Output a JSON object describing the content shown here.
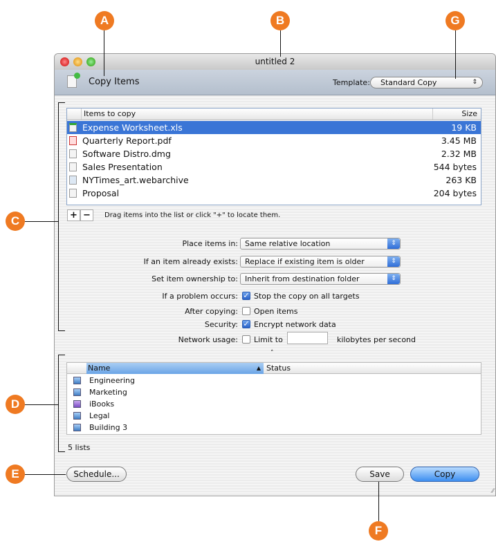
{
  "callouts": {
    "a": "A",
    "b": "B",
    "c": "C",
    "d": "D",
    "e": "E",
    "f": "F",
    "g": "G"
  },
  "window": {
    "title": "untitled 2"
  },
  "toolbar": {
    "action": "Copy Items",
    "template_label": "Template:",
    "template_value": "Standard Copy"
  },
  "items_table": {
    "headers": [
      "Items to copy",
      "Size"
    ],
    "rows": [
      {
        "name": "Expense Worksheet.xls",
        "size": "19 KB",
        "selected": true
      },
      {
        "name": "Quarterly Report.pdf",
        "size": "3.45 MB"
      },
      {
        "name": "Software Distro.dmg",
        "size": "2.32 MB"
      },
      {
        "name": "Sales Presentation",
        "size": "544 bytes"
      },
      {
        "name": "NYTimes_art.webarchive",
        "size": "263 KB"
      },
      {
        "name": "Proposal",
        "size": "204 bytes"
      }
    ]
  },
  "add_remove": {
    "add": "+",
    "remove": "−",
    "hint": "Drag items into the list or click \"+\" to locate them."
  },
  "options": {
    "place_label": "Place items in:",
    "place_value": "Same relative location",
    "exists_label": "If an item already exists:",
    "exists_value": "Replace if existing item is older",
    "owner_label": "Set item ownership to:",
    "owner_value": "Inherit from destination folder",
    "problem_label": "If a problem occurs:",
    "problem_text": "Stop the copy on all targets",
    "problem_checked": true,
    "after_label": "After copying:",
    "after_text": "Open items",
    "after_checked": false,
    "security_label": "Security:",
    "security_text": "Encrypt network data",
    "security_checked": true,
    "network_label": "Network usage:",
    "network_text": "Limit to",
    "network_value": "",
    "network_unit": "kilobytes per second",
    "network_checked": false
  },
  "lists_table": {
    "headers": [
      "Name",
      "Status"
    ],
    "rows": [
      {
        "name": "Engineering"
      },
      {
        "name": "Marketing"
      },
      {
        "name": "iBooks"
      },
      {
        "name": "Legal"
      },
      {
        "name": "Building 3"
      }
    ],
    "count": "5 lists"
  },
  "buttons": {
    "schedule": "Schedule...",
    "save": "Save",
    "copy": "Copy"
  },
  "colors": {
    "callout": "#ef7a22",
    "selection": "#3a75d6"
  }
}
